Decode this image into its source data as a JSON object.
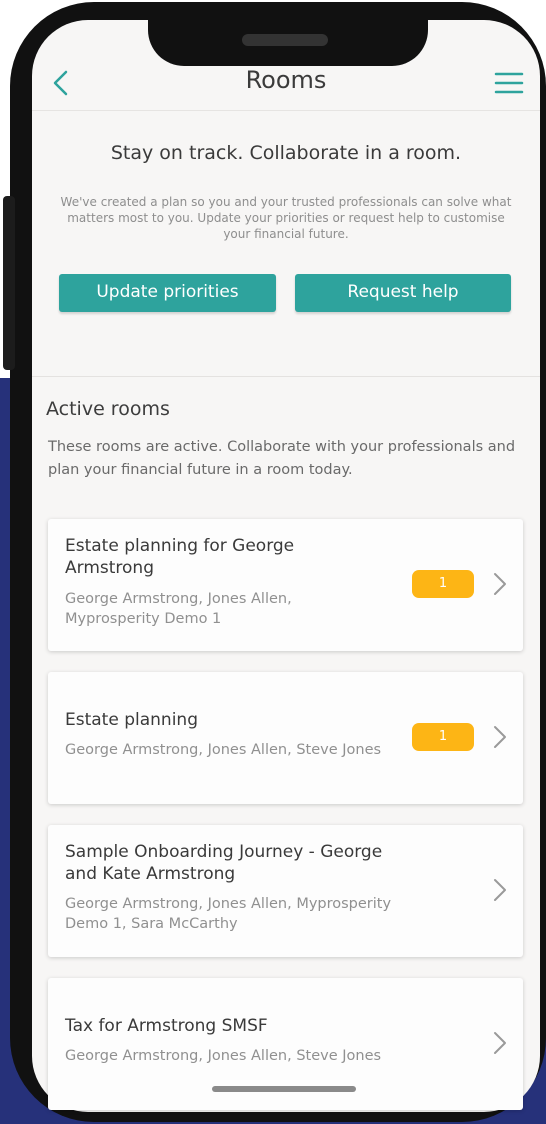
{
  "header": {
    "title": "Rooms",
    "back_icon": "chevron-left-icon",
    "menu_icon": "hamburger-menu-icon"
  },
  "intro": {
    "heading": "Stay on track. Collaborate in a room.",
    "description": "We've created a plan so you and your trusted professionals can solve what matters most to you. Update your priorities or request help to customise your financial future.",
    "update_button": "Update priorities",
    "help_button": "Request help"
  },
  "active_rooms": {
    "heading": "Active rooms",
    "description": "These rooms are active. Collaborate with your professionals and plan your financial future in a room today.",
    "rooms": [
      {
        "title": "Estate planning for George Armstrong",
        "members": "George Armstrong, Jones Allen, Myprosperity Demo 1",
        "badge": "1"
      },
      {
        "title": "Estate planning",
        "members": "George Armstrong, Jones Allen, Steve Jones",
        "badge": "1"
      },
      {
        "title": "Sample Onboarding Journey - George and Kate Armstrong",
        "members": "George Armstrong, Jones Allen, Myprosperity Demo 1, Sara McCarthy",
        "badge": ""
      },
      {
        "title": "Tax  for Armstrong SMSF",
        "members": "George Armstrong, Jones Allen, Steve Jones",
        "badge": ""
      }
    ]
  },
  "colors": {
    "accent": "#2ea39d",
    "badge": "#fdb515",
    "background_outer": "#26317a"
  }
}
